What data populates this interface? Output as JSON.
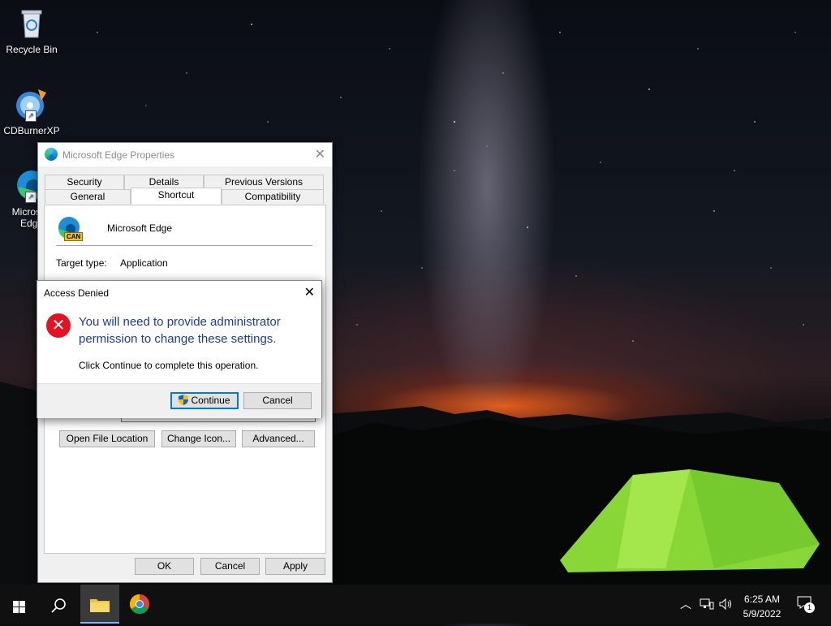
{
  "desktop": {
    "icons": [
      {
        "label": "Recycle Bin"
      },
      {
        "label": "CDBurnerXP"
      },
      {
        "label": "Microsoft Edge"
      }
    ]
  },
  "properties_window": {
    "title": "Microsoft Edge Properties",
    "tabs_row1": [
      "Security",
      "Details",
      "Previous Versions"
    ],
    "tabs_row2": [
      "General",
      "Shortcut",
      "Compatibility"
    ],
    "active_tab": "Shortcut",
    "app_name": "Microsoft Edge",
    "icon_badge": "CAN",
    "target_type_label": "Target type:",
    "target_type_value": "Application",
    "buttons": {
      "open_file_location": "Open File Location",
      "change_icon": "Change Icon...",
      "advanced": "Advanced...",
      "ok": "OK",
      "cancel": "Cancel",
      "apply": "Apply"
    }
  },
  "access_denied": {
    "title": "Access Denied",
    "message": "You will need to provide administrator permission to change these settings.",
    "sub_message": "Click Continue to complete this operation.",
    "continue_label": "Continue",
    "cancel_label": "Cancel"
  },
  "taskbar": {
    "time": "6:25 AM",
    "date": "5/9/2022",
    "notification_count": "1"
  },
  "colors": {
    "link_blue": "#1a3d9c",
    "error_red": "#e81123",
    "tent_green": "#8fe33a"
  }
}
